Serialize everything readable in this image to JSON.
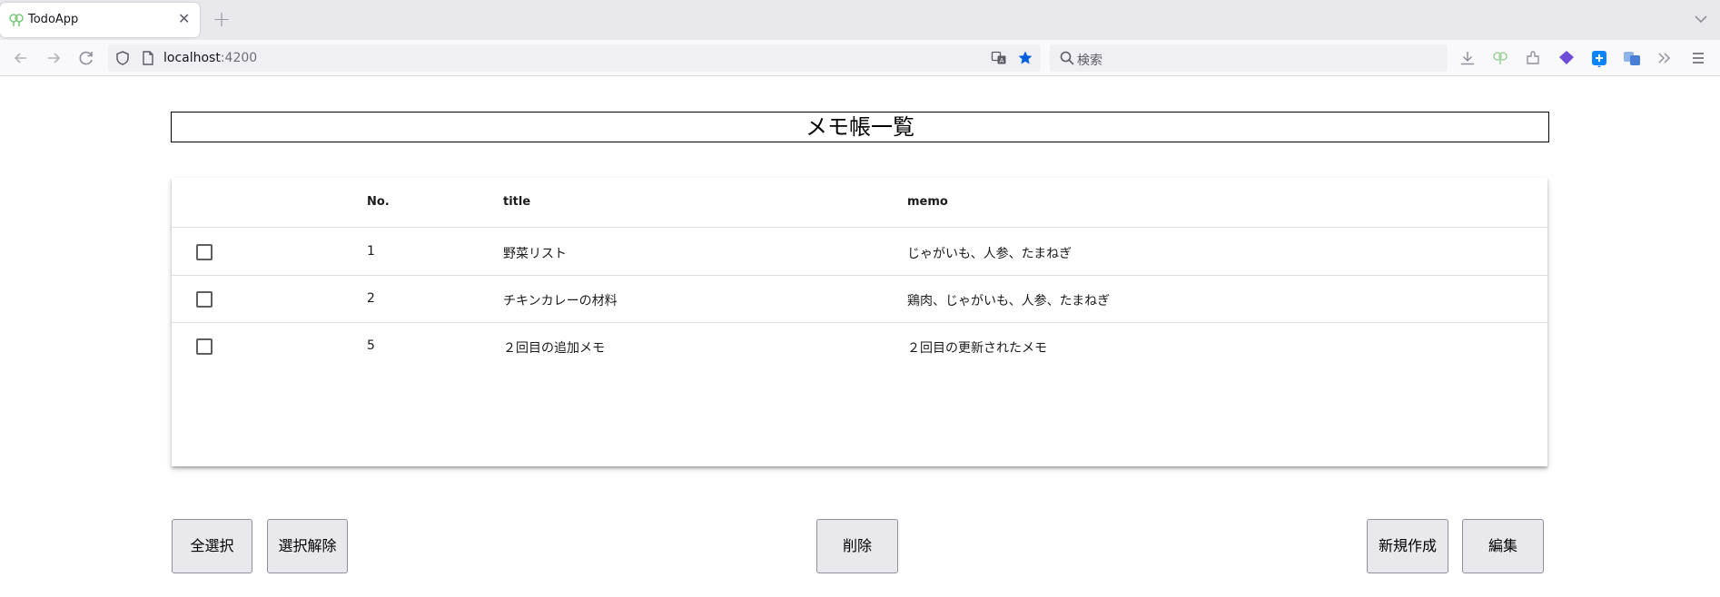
{
  "browser": {
    "tab": {
      "title": "TodoApp"
    },
    "urlbar": {
      "host": "localhost",
      "port": ":4200"
    },
    "searchbar": {
      "placeholder": "検索"
    },
    "colors": {
      "star": "#0060df",
      "favicon": "#7fc97f",
      "accent_blue": "#0a84ff",
      "accent_purple": "#6e4cd8"
    }
  },
  "page": {
    "title": "メモ帳一覧",
    "table": {
      "headers": {
        "no": "No.",
        "title": "title",
        "memo": "memo"
      },
      "rows": [
        {
          "no": "1",
          "title": "野菜リスト",
          "memo": "じゃがいも、人参、たまねぎ"
        },
        {
          "no": "2",
          "title": "チキンカレーの材料",
          "memo": "鶏肉、じゃがいも、人参、たまねぎ"
        },
        {
          "no": "5",
          "title": "２回目の追加メモ",
          "memo": "２回目の更新されたメモ"
        }
      ]
    },
    "buttons": {
      "select_all": "全選択",
      "deselect": "選択解除",
      "delete": "削除",
      "create": "新規作成",
      "edit": "編集"
    }
  }
}
